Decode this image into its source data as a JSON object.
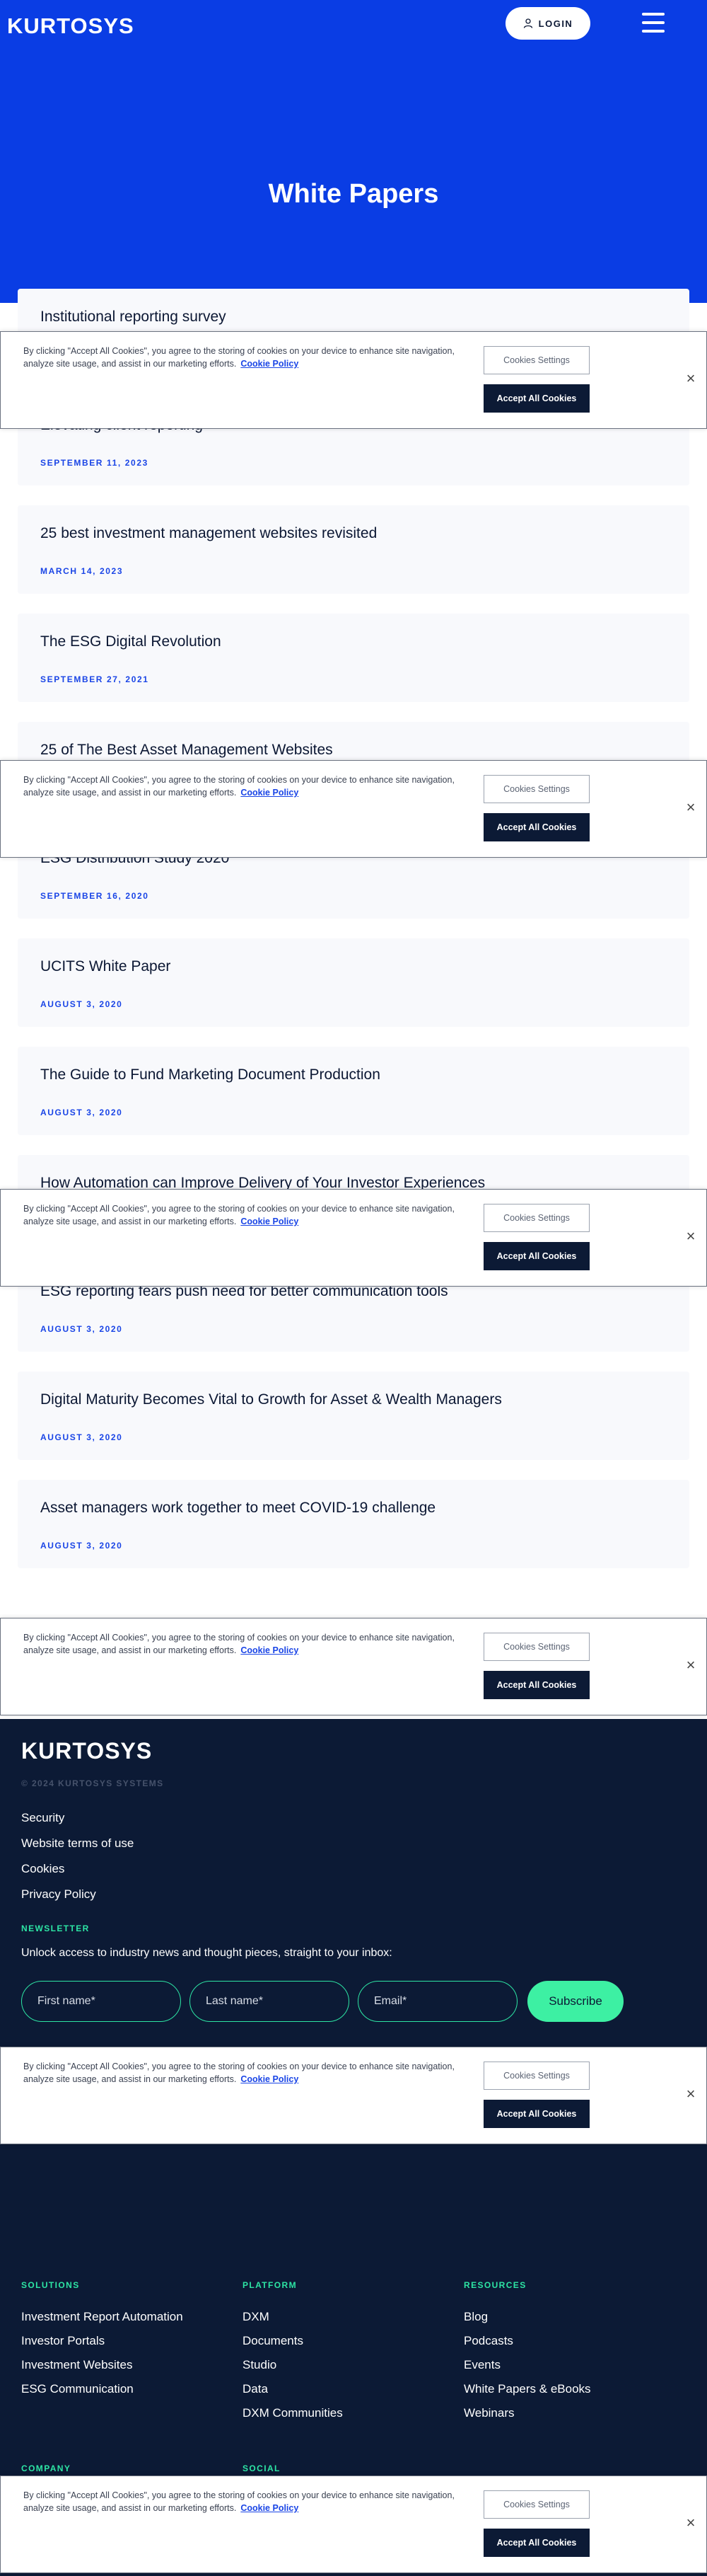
{
  "header": {
    "logo": "KURTOSYS",
    "login_label": "LOGIN",
    "hero_title": "White Papers"
  },
  "cards": [
    {
      "title": "Institutional reporting survey",
      "date": ""
    },
    {
      "title": "Elevating client reporting",
      "date": "SEPTEMBER 11, 2023"
    },
    {
      "title": "25 best investment management websites revisited",
      "date": "MARCH 14, 2023"
    },
    {
      "title": "The ESG Digital Revolution",
      "date": "SEPTEMBER 27, 2021"
    },
    {
      "title": "25 of The Best Asset Management Websites",
      "date": ""
    },
    {
      "title": "ESG Distribution Study 2020",
      "date": "SEPTEMBER 16, 2020"
    },
    {
      "title": "UCITS White Paper",
      "date": "AUGUST 3, 2020"
    },
    {
      "title": "The Guide to Fund Marketing Document Production",
      "date": "AUGUST 3, 2020"
    },
    {
      "title": "How Automation can Improve Delivery of Your Investor Experiences",
      "date": ""
    },
    {
      "title": "ESG reporting fears push need for better communication tools",
      "date": "AUGUST 3, 2020"
    },
    {
      "title": "Digital Maturity Becomes Vital to Growth for Asset & Wealth Managers",
      "date": "AUGUST 3, 2020"
    },
    {
      "title": "Asset managers work together to meet COVID-19 challenge",
      "date": "AUGUST 3, 2020"
    }
  ],
  "cookie": {
    "text": "By clicking \"Accept All Cookies\", you agree to the storing of cookies on your device to enhance site navigation, analyze site usage, and assist in our marketing efforts.",
    "link": "Cookie Policy",
    "settings_label": "Cookies Settings",
    "accept_label": "Accept All Cookies"
  },
  "footer": {
    "logo": "KURTOSYS",
    "copyright": "© 2024 KURTOSYS SYSTEMS",
    "legal_links": [
      "Security",
      "Website terms of use",
      "Cookies",
      "Privacy Policy"
    ],
    "newsletter": {
      "label": "NEWSLETTER",
      "text": "Unlock access to industry news and thought pieces, straight to your inbox:",
      "first_name_placeholder": "First name*",
      "last_name_placeholder": "Last name*",
      "email_placeholder": "Email*",
      "subscribe_label": "Subscribe"
    },
    "columns": {
      "solutions": {
        "heading": "SOLUTIONS",
        "items": [
          "Investment Report Automation",
          "Investor Portals",
          "Investment Websites",
          "ESG Communication"
        ]
      },
      "platform": {
        "heading": "PLATFORM",
        "items": [
          "DXM",
          "Documents",
          "Studio",
          "Data",
          "DXM Communities"
        ]
      },
      "resources": {
        "heading": "RESOURCES",
        "items": [
          "Blog",
          "Podcasts",
          "Events",
          "White Papers & eBooks",
          "Webinars"
        ]
      },
      "company": {
        "heading": "COMPANY"
      },
      "social": {
        "heading": "SOCIAL"
      }
    }
  },
  "colors": {
    "brand_blue": "#0a3de4",
    "navy": "#0c1a35",
    "accent_green": "#2de5a4",
    "date_blue": "#1a45e6"
  }
}
